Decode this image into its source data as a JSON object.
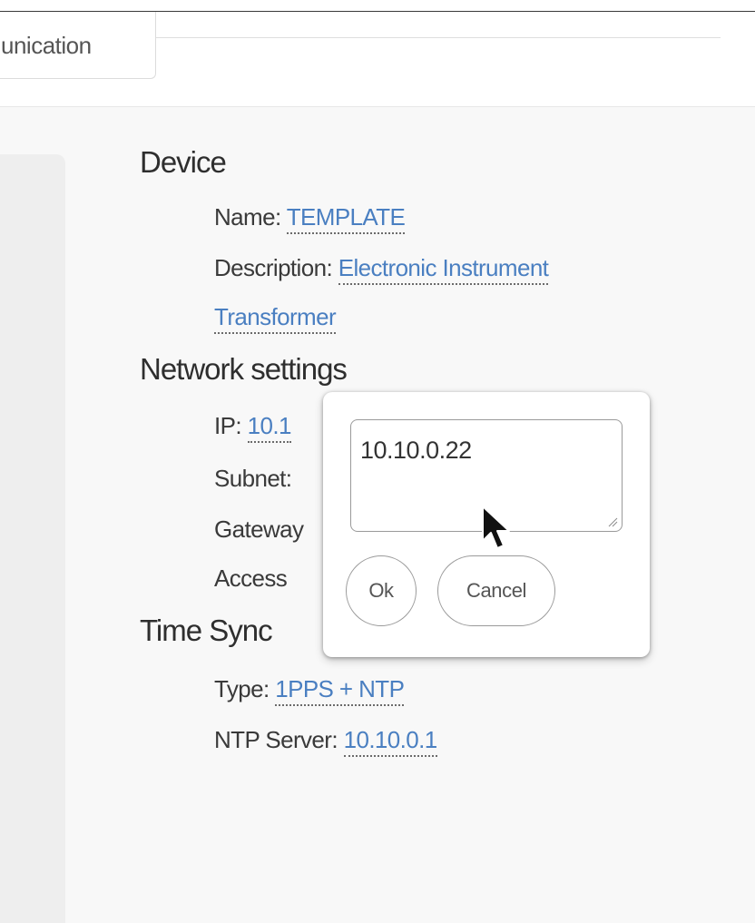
{
  "tabs": {
    "active_label": "unication"
  },
  "sections": {
    "device": {
      "title": "Device",
      "name_label": "Name: ",
      "name_value": "TEMPLATE",
      "description_label": "Description: ",
      "description_value_line1": "Electronic Instrument",
      "description_value_line2": "Transformer"
    },
    "network": {
      "title": "Network settings",
      "ip_label": "IP: ",
      "ip_value_partial": "10.1",
      "subnet_label": "Subnet:",
      "gateway_label": "Gateway",
      "access_label": "Access"
    },
    "time_sync": {
      "title": "Time Sync",
      "type_label": "Type: ",
      "type_value": "1PPS + NTP",
      "ntp_label": "NTP Server: ",
      "ntp_value": "10.10.0.1"
    }
  },
  "popover": {
    "input_value": "10.10.0.22",
    "ok_label": "Ok",
    "cancel_label": "Cancel"
  },
  "icons": {
    "cursor": "arrow-cursor-icon",
    "resize": "resize-grip-icon"
  },
  "colors": {
    "link": "#4a7fc1",
    "text": "#2e2e2e",
    "content_bg": "#f8f8f8"
  }
}
